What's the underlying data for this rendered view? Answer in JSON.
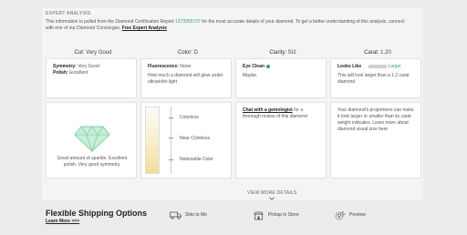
{
  "section_title": "EXPERT ANALYSIS",
  "intro": {
    "text1": "This information is pulled from the Diamond Certification Report ",
    "report_number": "1373055737",
    "text2": " for the most accurate details of your diamond. To get a better understanding of this analysis, connect with one of our Diamond Concierges. ",
    "cta": "Free Expert Analysis"
  },
  "columns": [
    {
      "label": "Cut:",
      "value": "Very Good"
    },
    {
      "label": "Color:",
      "value": "D"
    },
    {
      "label": "Clarity:",
      "value": "SI2"
    },
    {
      "label": "Carat:",
      "value": "1.20"
    }
  ],
  "cut_card": {
    "symmetry_label": "Symmetry:",
    "symmetry_value": "Very Good",
    "polish_label": "Polish:",
    "polish_value": "Excellent"
  },
  "color_card": {
    "fluorescence_label": "Fluorescence:",
    "fluorescence_value": "None",
    "desc": "How much a diamond will glow under ultraviolet light"
  },
  "clarity_card": {
    "eye_clean_label": "Eye Clean",
    "eye_clean_value": "Maybe."
  },
  "carat_card": {
    "looks_like_label": "Looks Like",
    "looks_like_range": "Larger",
    "desc": "This will look larger than a 1.2 carat diamond"
  },
  "cut_visual": {
    "caption": "Great amount of sparkle. Excellent polish. Very good symmetry."
  },
  "color_scale": {
    "labels": [
      "Colorless",
      "Near Colorless",
      "Noticeable Color"
    ]
  },
  "clarity_chat": {
    "title": "Chat with a gemologist",
    "desc": " for a thorough review of this diamond"
  },
  "carat_visual": {
    "desc": "Your diamond's proportions can make it look larger or smaller than its carat weight indicates. Learn more about diamond visual size here"
  },
  "view_more": "VIEW MORE DETAILS",
  "footer": {
    "title": "Flexible Shipping Options",
    "learn_more": "Learn More >>>",
    "items": [
      "Ship to Me",
      "Pickup in Store",
      "Preview"
    ]
  },
  "colors": {
    "accent": "#3a9d7f",
    "diamond": "#a8e0c2"
  }
}
